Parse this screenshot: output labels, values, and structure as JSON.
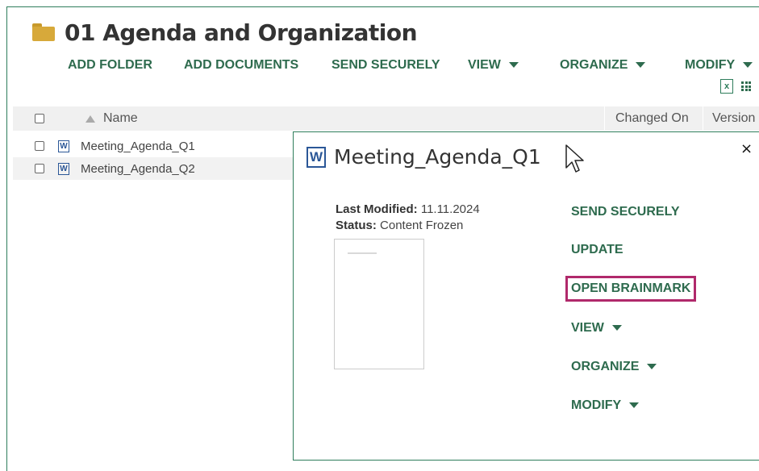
{
  "folder": {
    "title": "01 Agenda and Organization",
    "icon": "folder-icon"
  },
  "toolbar": {
    "add_folder": "ADD FOLDER",
    "add_documents": "ADD DOCUMENTS",
    "send_securely": "SEND SECURELY",
    "view": "VIEW",
    "organize": "ORGANIZE",
    "modify": "MODIFY"
  },
  "table": {
    "columns": {
      "name": "Name",
      "changed_on": "Changed On",
      "version": "Version"
    },
    "rows": [
      {
        "name": "Meeting_Agenda_Q1",
        "icon": "word-doc-icon"
      },
      {
        "name": "Meeting_Agenda_Q2",
        "icon": "word-doc-icon"
      }
    ]
  },
  "detail_panel": {
    "doc_title": "Meeting_Agenda_Q1",
    "last_modified_label": "Last Modified:",
    "last_modified_value": "11.11.2024",
    "status_label": "Status:",
    "status_value": "Content Frozen",
    "actions": {
      "send_securely": "SEND SECURELY",
      "update": "UPDATE",
      "open_brainmark": "OPEN BRAINMARK",
      "view": "VIEW",
      "organize": "ORGANIZE",
      "modify": "MODIFY"
    },
    "close_symbol": "×"
  },
  "colors": {
    "accent_green": "#2e6b4e",
    "border_green": "#2e7d5b",
    "highlight": "#b0296b",
    "folder": "#d7a93a",
    "word_blue": "#2b5797"
  }
}
